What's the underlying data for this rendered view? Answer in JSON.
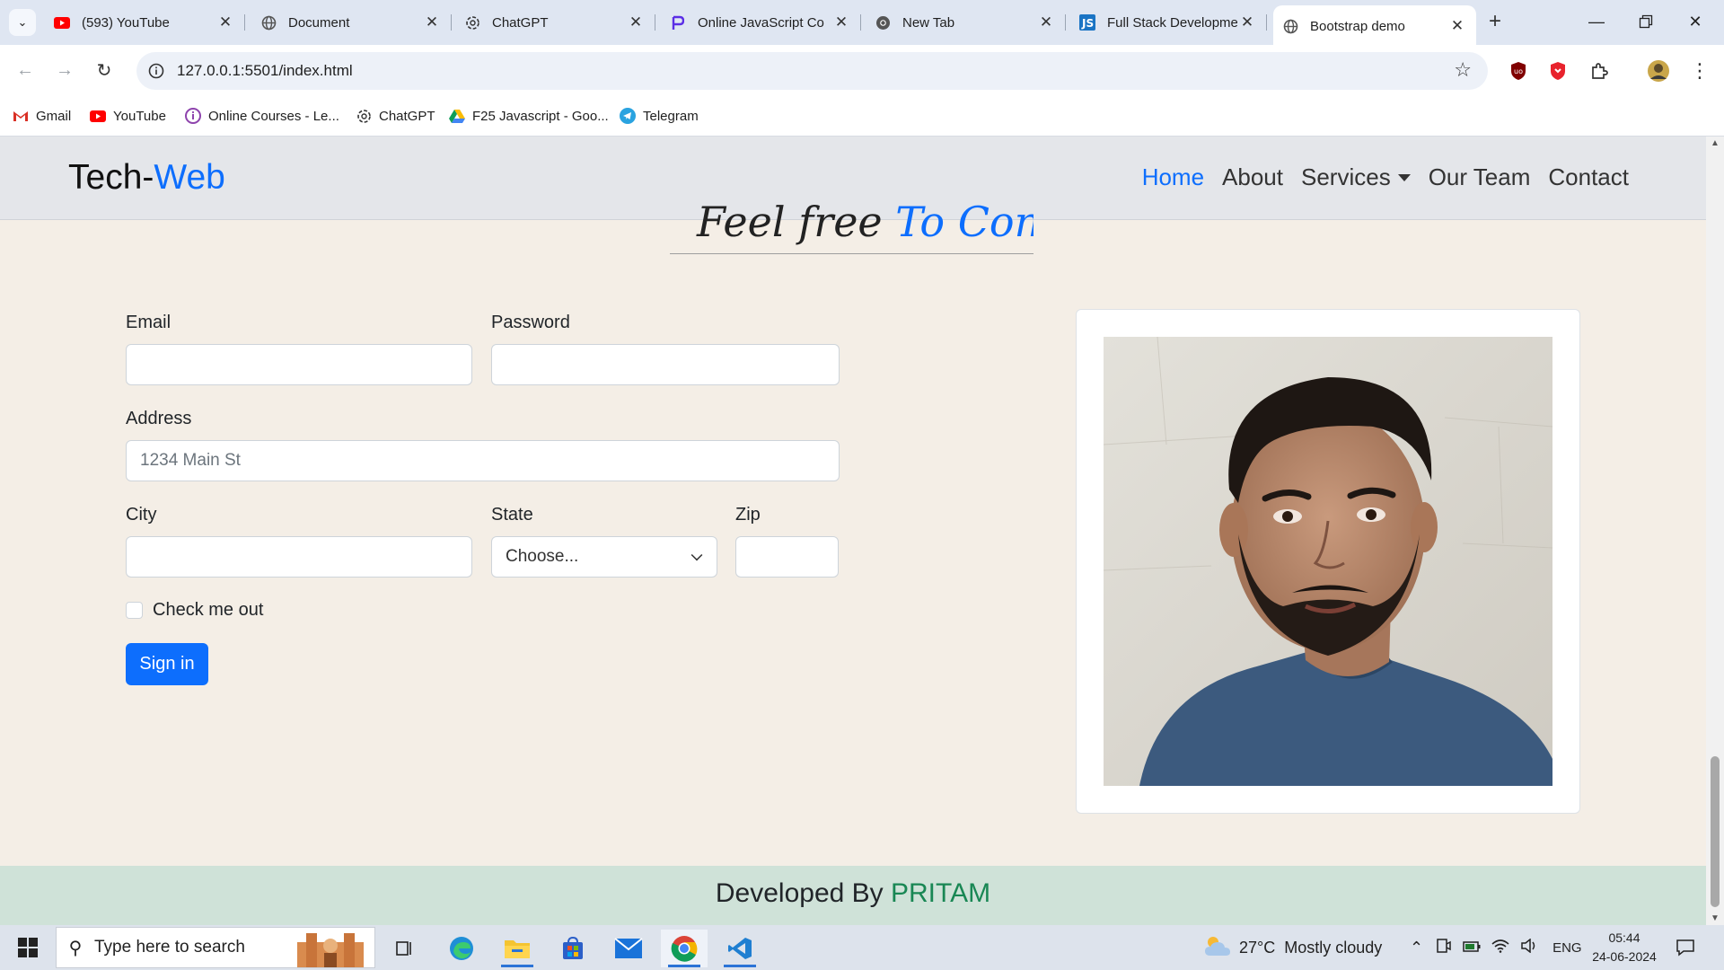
{
  "browser": {
    "tabs": [
      {
        "title": "(593) YouTube",
        "icon": "youtube-icon"
      },
      {
        "title": "Document",
        "icon": "globe-icon"
      },
      {
        "title": "ChatGPT",
        "icon": "chatgpt-icon"
      },
      {
        "title": "Online JavaScript Co",
        "icon": "programiz-icon"
      },
      {
        "title": "New Tab",
        "icon": "chrome-icon"
      },
      {
        "title": "Full Stack Developme",
        "icon": "jspiders-icon"
      },
      {
        "title": "Bootstrap demo",
        "icon": "globe-icon",
        "active": true
      }
    ],
    "url": "127.0.0.1:5501/index.html",
    "bookmarks": [
      {
        "label": "Gmail",
        "icon": "gmail-icon"
      },
      {
        "label": "YouTube",
        "icon": "youtube-icon"
      },
      {
        "label": "Online Courses - Le...",
        "icon": "courses-icon"
      },
      {
        "label": "ChatGPT",
        "icon": "chatgpt-icon"
      },
      {
        "label": "F25 Javascript - Goo...",
        "icon": "google-drive-icon"
      },
      {
        "label": "Telegram",
        "icon": "telegram-icon"
      }
    ]
  },
  "site": {
    "brand_main": "Tech-",
    "brand_accent": "Web",
    "nav": [
      {
        "label": "Home",
        "active": true
      },
      {
        "label": "About"
      },
      {
        "label": "Services",
        "dropdown": true
      },
      {
        "label": "Our Team"
      },
      {
        "label": "Contact"
      }
    ],
    "heading_main": "Feel free ",
    "heading_accent": "To Contact",
    "form": {
      "email_label": "Email",
      "password_label": "Password",
      "address_label": "Address",
      "address_placeholder": "1234 Main St",
      "city_label": "City",
      "state_label": "State",
      "state_selected": "Choose...",
      "zip_label": "Zip",
      "check_label": "Check me out",
      "submit_label": "Sign in"
    },
    "footer_main": "Developed By ",
    "footer_accent": "PRITAM"
  },
  "taskbar": {
    "search_placeholder": "Type here to search",
    "weather_temp": "27°C",
    "weather_text": "Mostly cloudy",
    "language": "ENG",
    "time": "05:44",
    "date": "24-06-2024"
  },
  "colors": {
    "accent": "#0d6efd",
    "footer_accent": "#198754",
    "page_bg": "#f4eee6",
    "navbar_bg": "#e4e6ea",
    "footer_bg": "#cfe2d8"
  }
}
